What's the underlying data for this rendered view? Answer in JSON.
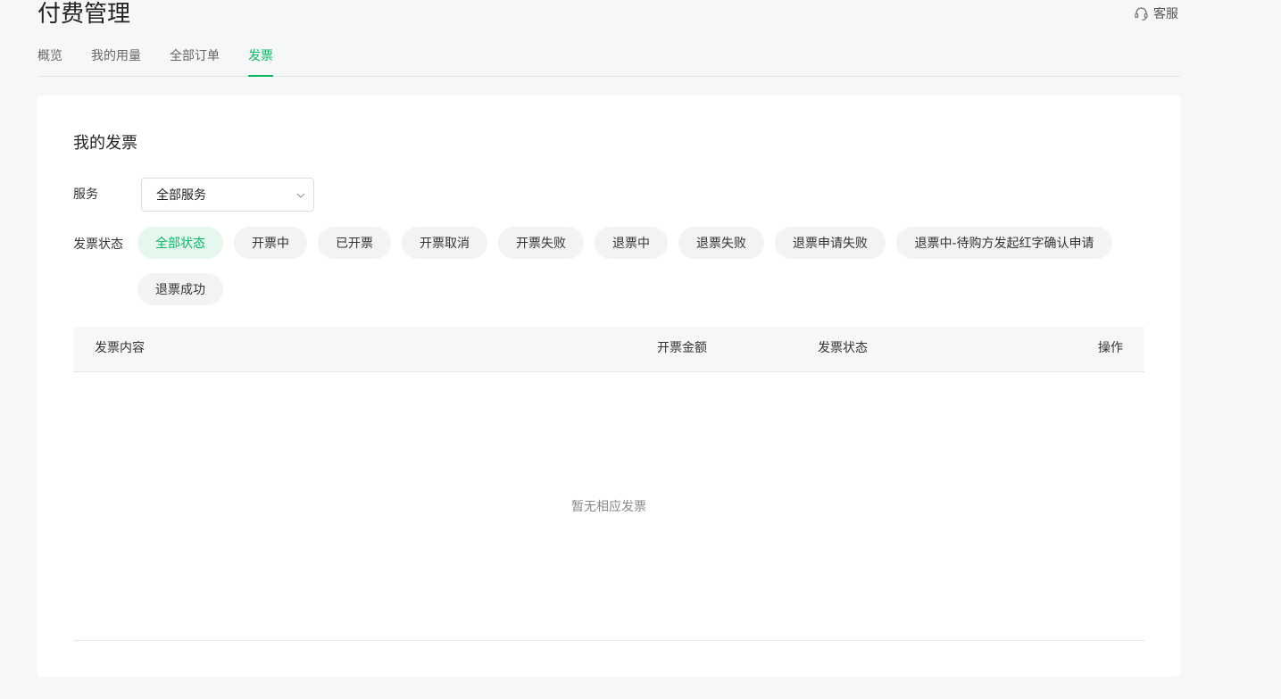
{
  "header": {
    "title": "付费管理",
    "support_label": "客服"
  },
  "tabs": [
    {
      "label": "概览",
      "active": false
    },
    {
      "label": "我的用量",
      "active": false
    },
    {
      "label": "全部订单",
      "active": false
    },
    {
      "label": "发票",
      "active": true
    }
  ],
  "invoices": {
    "title": "我的发票",
    "service_label": "服务",
    "service_select_value": "全部服务",
    "status_label": "发票状态",
    "status_chips": [
      {
        "label": "全部状态",
        "active": true
      },
      {
        "label": "开票中",
        "active": false
      },
      {
        "label": "已开票",
        "active": false
      },
      {
        "label": "开票取消",
        "active": false
      },
      {
        "label": "开票失败",
        "active": false
      },
      {
        "label": "退票中",
        "active": false
      },
      {
        "label": "退票失败",
        "active": false
      },
      {
        "label": "退票申请失败",
        "active": false
      },
      {
        "label": "退票中-待购方发起红字确认申请",
        "active": false
      },
      {
        "label": "退票成功",
        "active": false
      }
    ],
    "table": {
      "columns": [
        "发票内容",
        "开票金额",
        "发票状态",
        "操作"
      ],
      "rows": [],
      "empty_text": "暂无相应发票"
    }
  },
  "colors": {
    "accent": "#07b863",
    "accent_bg": "#e6f8ee",
    "page_bg": "#f6f7f8",
    "chip_bg": "#f2f3f5"
  },
  "icons": {
    "support": "headset-icon",
    "select": "chevron-down-icon"
  }
}
